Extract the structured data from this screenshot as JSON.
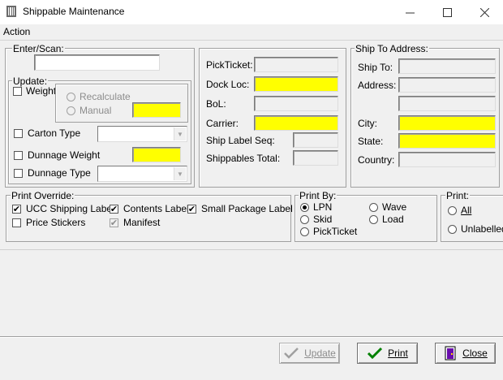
{
  "window": {
    "title": "Shippable Maintenance",
    "controls": {
      "minimize": "—",
      "maximize": "☐",
      "close": "✕"
    }
  },
  "menu": {
    "items": [
      "Action"
    ]
  },
  "enter_scan": {
    "label": "Enter/Scan:",
    "value": ""
  },
  "update": {
    "label": "Update:",
    "weight": {
      "label": "Weight",
      "checked": false
    },
    "recalculate": {
      "label": "Recalculate",
      "selected": false
    },
    "manual": {
      "label": "Manual",
      "value": ""
    },
    "carton_type": {
      "label": "Carton Type",
      "checked": false,
      "value": ""
    },
    "dunnage_weight": {
      "label": "Dunnage Weight",
      "checked": false,
      "value": ""
    },
    "dunnage_type": {
      "label": "Dunnage Type",
      "checked": false,
      "value": ""
    }
  },
  "pick_info": {
    "pickticket": {
      "label": "PickTicket:",
      "value": ""
    },
    "dock_loc": {
      "label": "Dock Loc:",
      "value": ""
    },
    "bol": {
      "label": "BoL:",
      "value": ""
    },
    "carrier": {
      "label": "Carrier:",
      "value": ""
    },
    "ship_label_seq": {
      "label": "Ship Label Seq:",
      "value": ""
    },
    "shippables_total": {
      "label": "Shippables Total:",
      "value": ""
    }
  },
  "ship_to": {
    "label": "Ship To Address:",
    "ship_to": {
      "label": "Ship To:",
      "value": ""
    },
    "address": {
      "label": "Address:",
      "value1": "",
      "value2": ""
    },
    "city": {
      "label": "City:",
      "value": ""
    },
    "state": {
      "label": "State:",
      "value": ""
    },
    "country": {
      "label": "Country:",
      "value": ""
    }
  },
  "print_override": {
    "label": "Print Override:",
    "ucc_shipping_label": {
      "label": "UCC Shipping Label",
      "checked": true
    },
    "contents_label": {
      "label": "Contents Label",
      "checked": true
    },
    "small_package_label": {
      "label": "Small Package Label",
      "checked": true
    },
    "price_stickers": {
      "label": "Price Stickers",
      "checked": false
    },
    "manifest": {
      "label": "Manifest",
      "checked": true
    }
  },
  "print_by": {
    "label": "Print By:",
    "options": [
      "LPN",
      "Wave",
      "Skid",
      "Load",
      "PickTicket"
    ],
    "selected": "LPN"
  },
  "print": {
    "label": "Print:",
    "all": "All",
    "unlabelled": "Unlabelled"
  },
  "buttons": {
    "update": "Update",
    "print": "Print",
    "close": "Close"
  },
  "colors": {
    "required_field": "#ffff00",
    "window_bg": "#f0f0f0"
  }
}
